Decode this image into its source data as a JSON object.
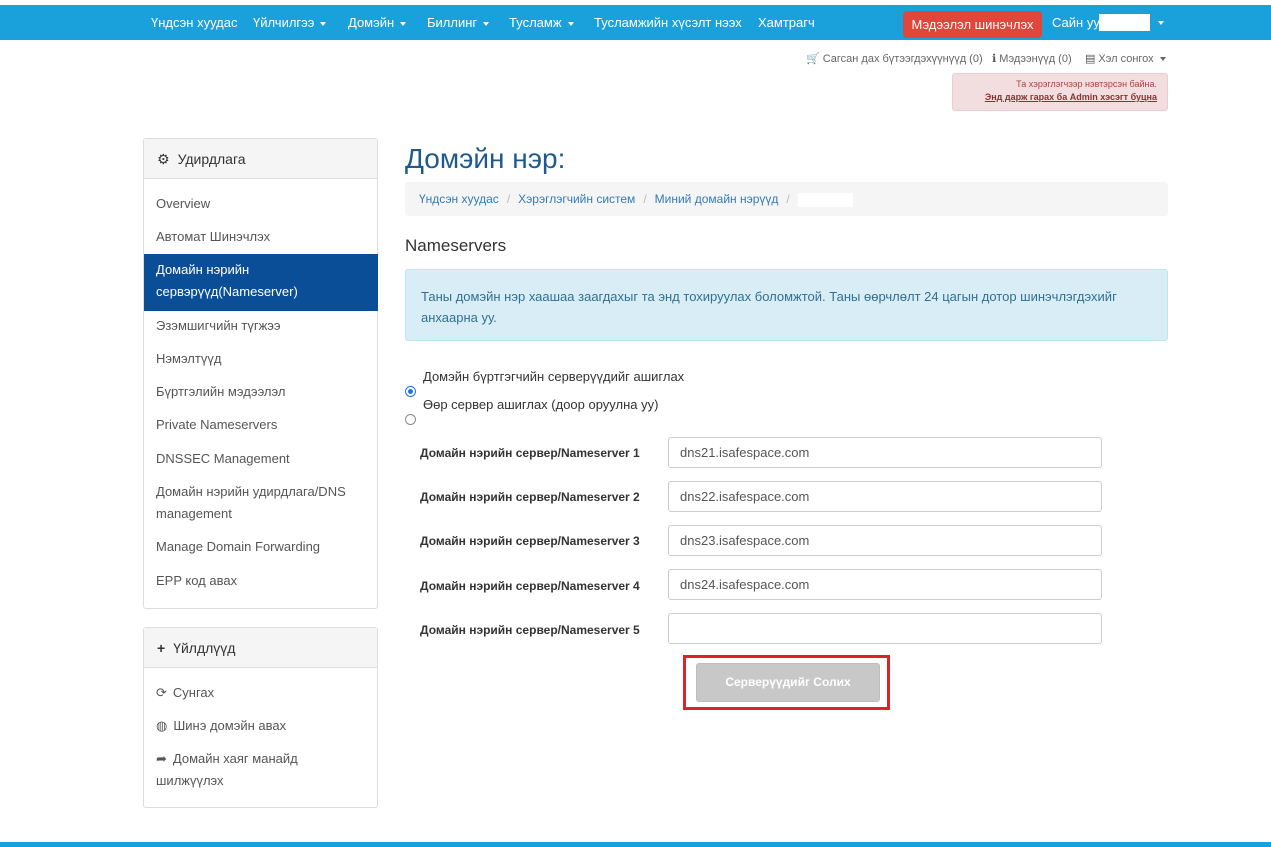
{
  "topnav": {
    "home": "Үндсэн хуудас",
    "services": "Үйлчилгээ",
    "domains": "Домэйн",
    "billing": "Биллинг",
    "support": "Тусламж",
    "open_ticket": "Тусламжийн хүсэлт нээх",
    "affiliates": "Хамтрагч",
    "update_button": "Мэдээлэл шинэчлэх",
    "greeting": "Сайн уу,"
  },
  "sublinks": {
    "cart": "Сагсан дах бүтээгдэхүүнүүд (0)",
    "notifications": "Мэдээнүүд (0)",
    "language": "Хэл сонгох"
  },
  "admin_alert": {
    "line1": "Та хэрэглэгчээр нэвтэрсэн байна.",
    "line2": "Энд дарж гарах ба Admin хэсэгт буцна"
  },
  "sidebar": {
    "manage_title": "Удирдлага",
    "items": [
      "Overview",
      "Автомат Шинэчлэх",
      "Домайн нэрийн сервэрүүд(Nameserver)",
      "Эзэмшигчийн түгжээ",
      "Нэмэлтүүд",
      "Бүртгэлийн мэдээлэл",
      "Private Nameservers",
      "DNSSEC Management",
      "Домайн нэрийн удирдлага/DNS management",
      "Manage Domain Forwarding",
      "EPP код авах"
    ],
    "actions_title": "Үйлдлүүд",
    "actions": [
      "Сунгах",
      "Шинэ домэйн авах",
      "Домайн хаяг манайд шилжүүлэх"
    ]
  },
  "main": {
    "title": "Домэйн нэр:",
    "breadcrumb": [
      "Үндсэн хуудас",
      "Хэрэглэгчийн систем",
      "Миний домайн нэрүүд"
    ],
    "section_title": "Nameservers",
    "info": "Таны домэйн нэр хаашаа заагдахыг та энд тохируулах боломжтой. Таны өөрчлөлт 24 цагын дотор шинэчлэгдэхийг анхаарна уу.",
    "radio_default": "Домэйн бүртгэгчийн серверүүдийг ашиглах",
    "radio_custom": "Өөр сервер ашиглах (доор оруулна уу)",
    "nameservers": [
      {
        "label": "Домайн нэрийн сервер/Nameserver 1",
        "value": "dns21.isafespace.com"
      },
      {
        "label": "Домайн нэрийн сервер/Nameserver 2",
        "value": "dns22.isafespace.com"
      },
      {
        "label": "Домайн нэрийн сервер/Nameserver 3",
        "value": "dns23.isafespace.com"
      },
      {
        "label": "Домайн нэрийн сервер/Nameserver 4",
        "value": "dns24.isafespace.com"
      },
      {
        "label": "Домайн нэрийн сервер/Nameserver 5",
        "value": ""
      }
    ],
    "submit": "Серверүүдийг Солих"
  },
  "colors": {
    "nav": "#1aa1dc",
    "active": "#0b4e98",
    "title": "#1f5a8e",
    "highlight": "#e0202a"
  }
}
